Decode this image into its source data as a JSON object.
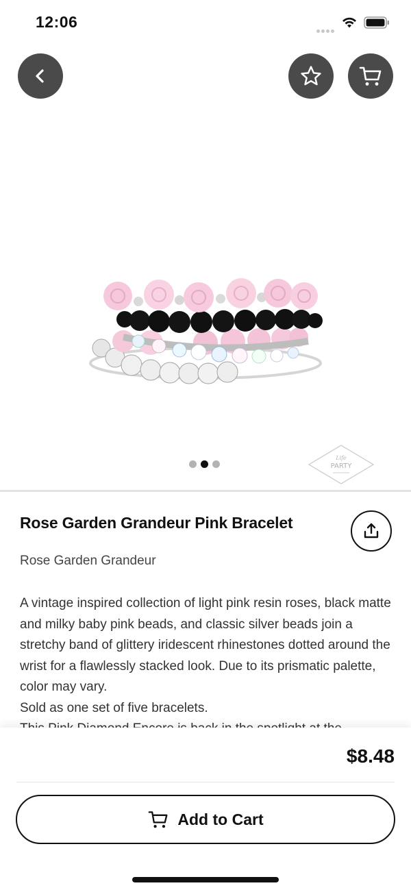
{
  "status_bar": {
    "time": "12:06"
  },
  "nav": {
    "back_icon": "chevron-left-icon",
    "favorite_icon": "star-icon",
    "cart_icon": "cart-icon"
  },
  "gallery": {
    "image_description_icon": "bracelet-stack-image",
    "page_count": 3,
    "active_page": 2,
    "brand_logo_text": [
      "Life",
      "PARTY"
    ]
  },
  "product": {
    "title": "Rose Garden Grandeur Pink Bracelet",
    "collection": "Rose Garden Grandeur",
    "description_lines": [
      "A vintage inspired collection of light pink resin roses, black matte and milky baby pink beads, and classic silver beads join a stretchy band of glittery iridescent rhinestones dotted around the wrist for a flawlessly stacked look. Due to its prismatic palette, color may vary.",
      "Sold as one set of five bracelets.",
      "This Pink Diamond Encore is back in the spotlight at the"
    ],
    "share_icon": "share-icon"
  },
  "purchase": {
    "price": "$8.48",
    "add_to_cart_label": "Add to Cart"
  },
  "colors": {
    "button_dark": "#4a4a4a",
    "text_primary": "#111111",
    "text_secondary": "#444444"
  }
}
